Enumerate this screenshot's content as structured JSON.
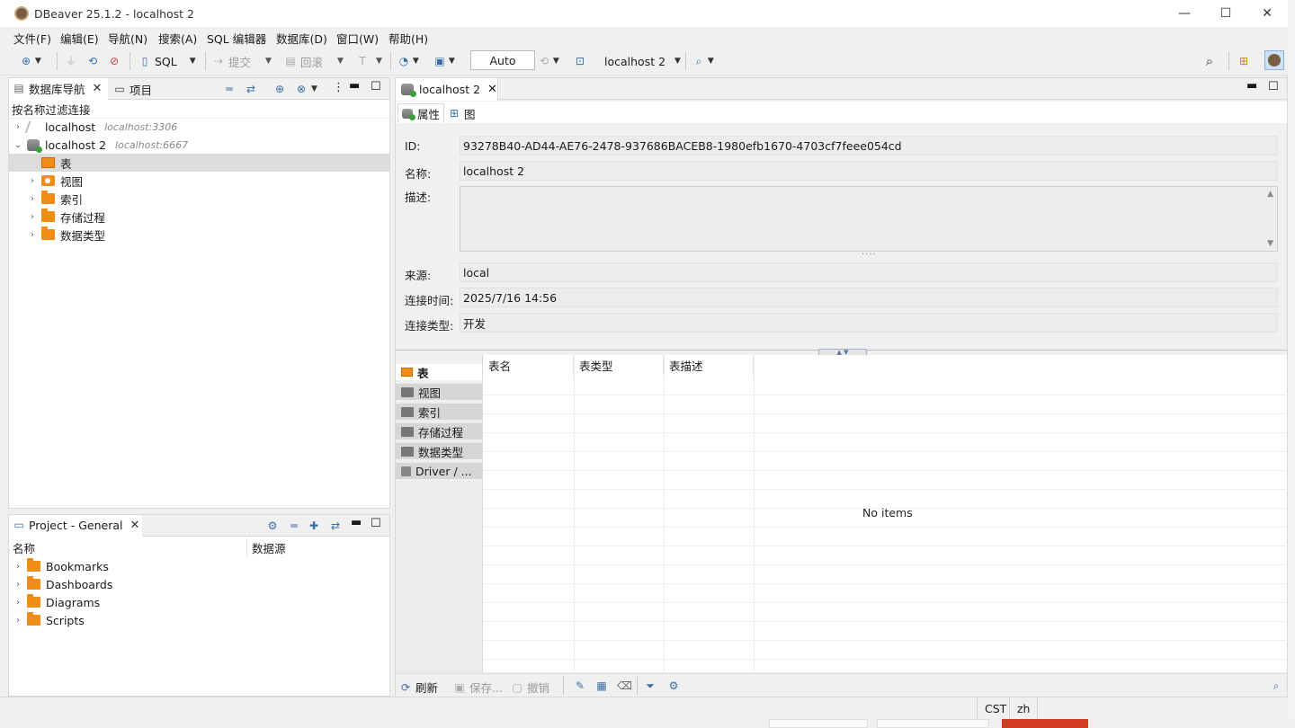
{
  "window": {
    "title": "DBeaver 25.1.2 - localhost 2",
    "minimize": "—",
    "maximize": "☐",
    "close": "✕"
  },
  "menu": [
    "文件(F)",
    "编辑(E)",
    "导航(N)",
    "搜索(A)",
    "SQL 编辑器",
    "数据库(D)",
    "窗口(W)",
    "帮助(H)"
  ],
  "toolbar": {
    "sql_label": "SQL",
    "commit_label": "提交",
    "rollback_label": "回滚",
    "transaction_mode": "Auto",
    "active_datasource": "localhost 2"
  },
  "navigator": {
    "tab_label": "数据库导航",
    "projects_tab_label": "项目",
    "filter_placeholder": "按名称过滤连接",
    "connections": [
      {
        "name": "localhost",
        "host": "localhost:3306"
      },
      {
        "name": "localhost 2",
        "host": "localhost:6667"
      }
    ],
    "children": [
      "表",
      "视图",
      "索引",
      "存储过程",
      "数据类型"
    ]
  },
  "project_panel": {
    "tab_label": "Project - General",
    "col_name": "名称",
    "col_datasource": "数据源",
    "items": [
      "Bookmarks",
      "Dashboards",
      "Diagrams",
      "Scripts"
    ]
  },
  "editor": {
    "tab_label": "localhost 2",
    "subtab_properties": "属性",
    "subtab_diagram": "图",
    "props": {
      "id_label": "ID:",
      "id_value": "93278B40-AD44-AE76-2478-937686BACEB8-1980efb1670-4703cf7feee054cd",
      "name_label": "名称:",
      "name_value": "localhost 2",
      "desc_label": "描述:",
      "source_label": "来源:",
      "source_value": "local",
      "conn_time_label": "连接时间:",
      "conn_time_value": "2025/7/16 14:56",
      "conn_type_label": "连接类型:",
      "conn_type_value": "开发"
    },
    "side_tabs": [
      "表",
      "视图",
      "索引",
      "存储过程",
      "数据类型",
      "Driver / ..."
    ],
    "grid_columns": [
      "表名",
      "表类型",
      "表描述"
    ],
    "empty_text": "No items",
    "grid_toolbar": {
      "refresh": "刷新",
      "save": "保存...",
      "cancel": "撤销"
    }
  },
  "status": {
    "timezone": "CST",
    "locale": "zh"
  },
  "colors": {
    "accent_orange": "#f08d16",
    "ok_green": "#3aa03a",
    "link_blue": "#3a6ea8"
  }
}
